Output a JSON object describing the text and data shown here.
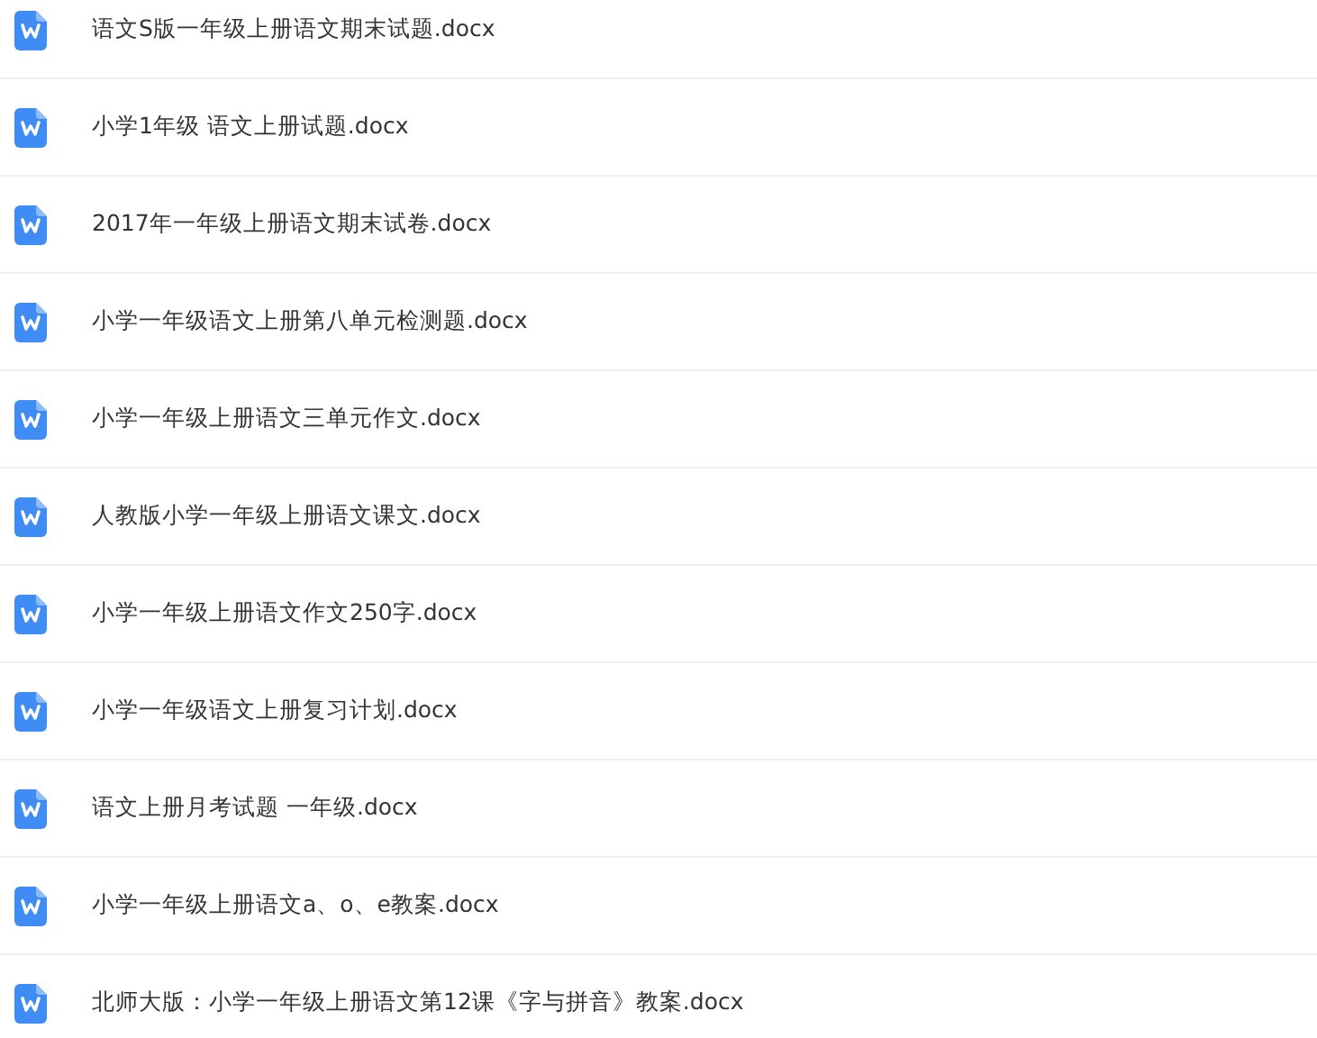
{
  "files": [
    {
      "name": "语文S版一年级上册语文期末试题.docx"
    },
    {
      "name": "小学1年级 语文上册试题.docx"
    },
    {
      "name": "2017年一年级上册语文期末试卷.docx"
    },
    {
      "name": "小学一年级语文上册第八单元检测题.docx"
    },
    {
      "name": "小学一年级上册语文三单元作文.docx"
    },
    {
      "name": "人教版小学一年级上册语文课文.docx"
    },
    {
      "name": "小学一年级上册语文作文250字.docx"
    },
    {
      "name": "小学一年级语文上册复习计划.docx"
    },
    {
      "name": "语文上册月考试题 一年级.docx"
    },
    {
      "name": "小学一年级上册语文a、o、e教案.docx"
    },
    {
      "name": "北师大版：小学一年级上册语文第12课《字与拼音》教案.docx"
    }
  ]
}
